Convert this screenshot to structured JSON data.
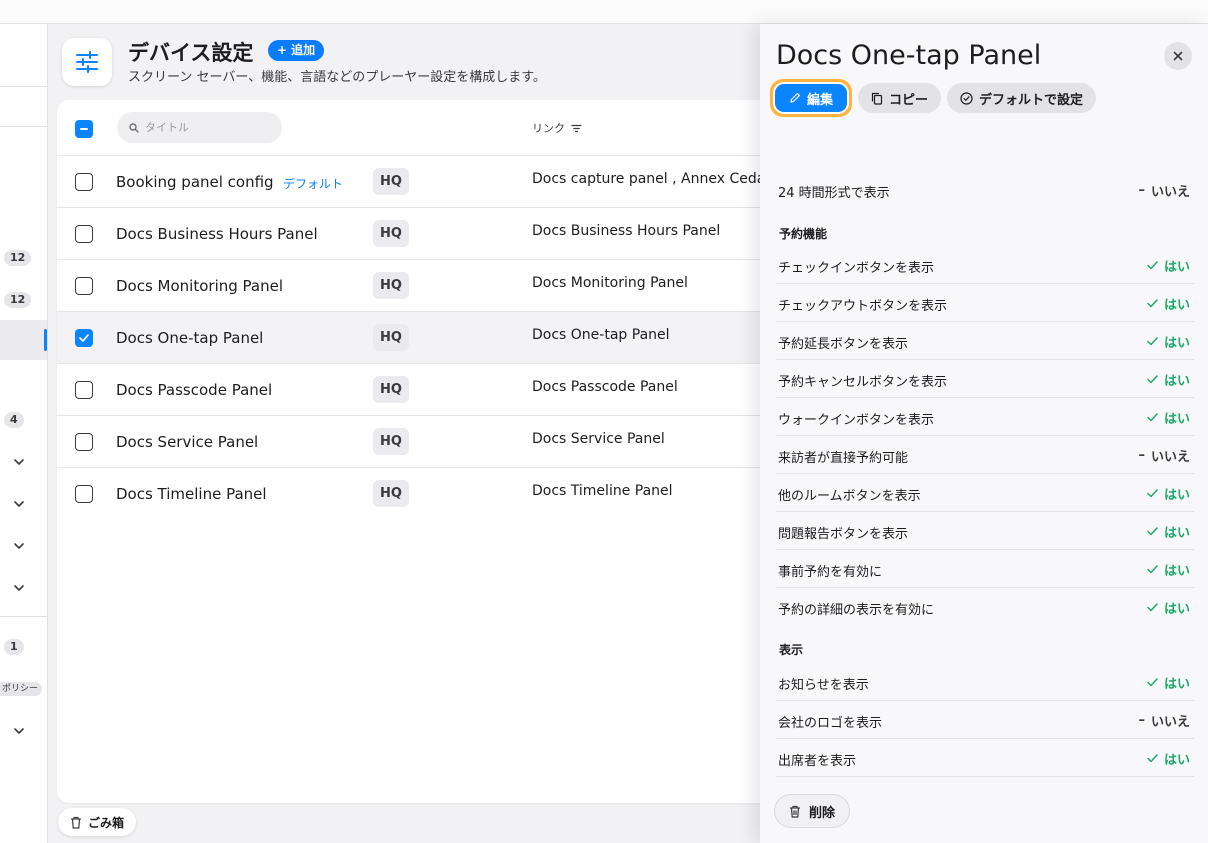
{
  "header": {
    "title": "デバイス設定",
    "add_label": "追加",
    "subtitle": "スクリーン セーバー、機能、言語などのプレーヤー設定を構成します。"
  },
  "sidebar": {
    "badges": [
      "12",
      "12",
      "4",
      "1"
    ],
    "tag_fragment": "ポリシー"
  },
  "table": {
    "search_placeholder": "タイトル",
    "link_column": "リンク",
    "rows": [
      {
        "title": "Booking panel config",
        "default_label": "デフォルト",
        "location": "HQ",
        "link": "Docs capture panel , Annex Ceda",
        "selected": false
      },
      {
        "title": "Docs Business Hours Panel",
        "location": "HQ",
        "link": "Docs Business Hours Panel",
        "selected": false
      },
      {
        "title": "Docs Monitoring Panel",
        "location": "HQ",
        "link": "Docs Monitoring Panel",
        "selected": false
      },
      {
        "title": "Docs One-tap Panel",
        "location": "HQ",
        "link": "Docs One-tap Panel",
        "selected": true
      },
      {
        "title": "Docs Passcode Panel",
        "location": "HQ",
        "link": "Docs Passcode Panel",
        "selected": false
      },
      {
        "title": "Docs Service Panel",
        "location": "HQ",
        "link": "Docs Service Panel",
        "selected": false
      },
      {
        "title": "Docs Timeline Panel",
        "location": "HQ",
        "link": "Docs Timeline Panel",
        "selected": false
      }
    ]
  },
  "trash_label": "ごみ箱",
  "panel": {
    "title": "Docs One-tap Panel",
    "edit_label": "編集",
    "copy_label": "コピー",
    "set_default_label": "デフォルトで設定",
    "general": [
      {
        "label": "24 時間形式で表示",
        "value": "いいえ",
        "state": "no"
      }
    ],
    "booking_section": "予約機能",
    "booking": [
      {
        "label": "チェックインボタンを表示",
        "value": "はい",
        "state": "yes"
      },
      {
        "label": "チェックアウトボタンを表示",
        "value": "はい",
        "state": "yes"
      },
      {
        "label": "予約延長ボタンを表示",
        "value": "はい",
        "state": "yes"
      },
      {
        "label": "予約キャンセルボタンを表示",
        "value": "はい",
        "state": "yes"
      },
      {
        "label": "ウォークインボタンを表示",
        "value": "はい",
        "state": "yes"
      },
      {
        "label": "来訪者が直接予約可能",
        "value": "いいえ",
        "state": "no"
      },
      {
        "label": "他のルームボタンを表示",
        "value": "はい",
        "state": "yes"
      },
      {
        "label": "問題報告ボタンを表示",
        "value": "はい",
        "state": "yes"
      },
      {
        "label": "事前予約を有効に",
        "value": "はい",
        "state": "yes"
      },
      {
        "label": "予約の詳細の表示を有効に",
        "value": "はい",
        "state": "yes"
      }
    ],
    "display_section": "表示",
    "display": [
      {
        "label": "お知らせを表示",
        "value": "はい",
        "state": "yes"
      },
      {
        "label": "会社のロゴを表示",
        "value": "いいえ",
        "state": "no"
      },
      {
        "label": "出席者を表示",
        "value": "はい",
        "state": "yes"
      }
    ],
    "delete_label": "削除"
  },
  "colors": {
    "accent": "#0a84ff",
    "yes": "#1fa86b",
    "focus_ring": "#ffb340"
  }
}
